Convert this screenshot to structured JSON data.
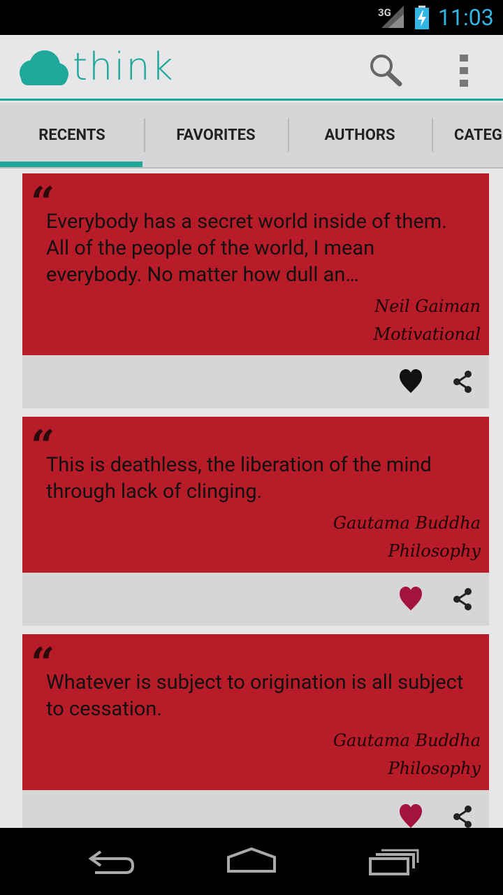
{
  "status_bar": {
    "network": "3G",
    "time": "11:03"
  },
  "app_bar": {
    "logo_text": "think"
  },
  "tabs": [
    {
      "label": "RECENTS",
      "selected": true
    },
    {
      "label": "FAVORITES",
      "selected": false
    },
    {
      "label": "AUTHORS",
      "selected": false
    },
    {
      "label": "CATEG",
      "selected": false
    }
  ],
  "quotes": [
    {
      "text": "Everybody has a secret world inside of them. All of the people of the world, I mean everybody. No matter how dull an…",
      "author": "Neil Gaiman",
      "category": "Motivational",
      "favorited": false
    },
    {
      "text": "This is deathless, the liberation of the mind through lack of clinging.",
      "author": "Gautama Buddha",
      "category": "Philosophy",
      "favorited": true
    },
    {
      "text": "Whatever is subject to origination is all subject to cessation.",
      "author": "Gautama Buddha",
      "category": "Philosophy",
      "favorited": true
    }
  ],
  "colors": {
    "accent": "#1fa79a",
    "card": "#b81c28",
    "heart_inactive": "#111111",
    "heart_active": "#a3133e"
  },
  "icons": {
    "search": "search-icon",
    "overflow": "overflow-menu-icon",
    "favorite": "heart-icon",
    "share": "share-icon",
    "back": "back-icon",
    "home": "home-icon",
    "recents": "recent-apps-icon"
  }
}
